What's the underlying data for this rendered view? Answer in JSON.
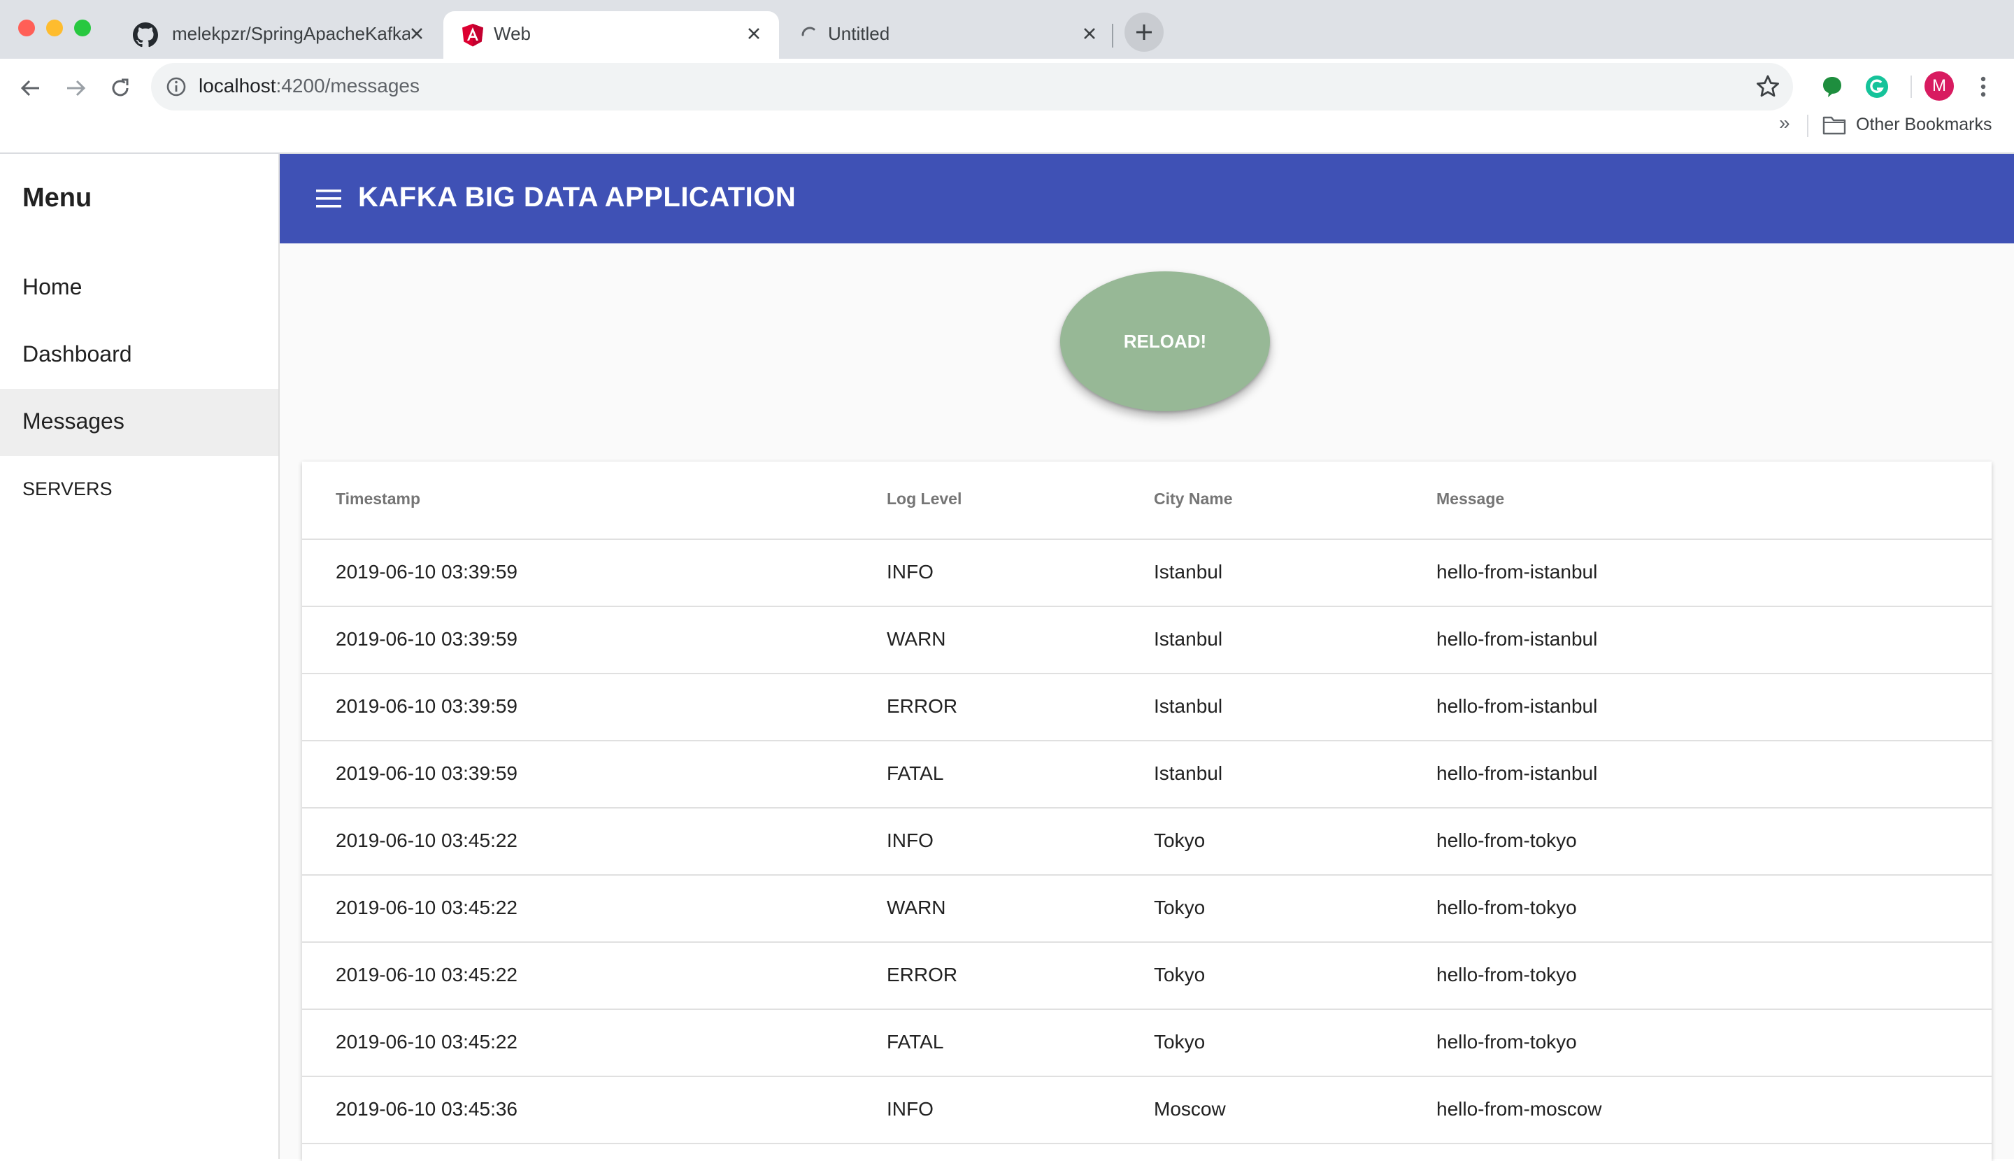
{
  "browser": {
    "tabs": [
      {
        "title": "melekpzr/SpringApacheKafka:",
        "icon": "github-icon"
      },
      {
        "title": "Web",
        "icon": "angular-icon"
      },
      {
        "title": "Untitled",
        "icon": "loading-spinner-icon"
      }
    ],
    "url_host": "localhost",
    "url_path": ":4200/messages",
    "profile_initial": "M",
    "bookmarks_overflow": "»",
    "other_bookmarks": "Other Bookmarks"
  },
  "sidebar": {
    "title": "Menu",
    "items": [
      {
        "label": "Home"
      },
      {
        "label": "Dashboard"
      },
      {
        "label": "Messages"
      },
      {
        "label": "SERVERS"
      }
    ]
  },
  "header": {
    "title": "KAFKA BIG DATA APPLICATION"
  },
  "reload_button": "RELOAD!",
  "table": {
    "columns": [
      "Timestamp",
      "Log Level",
      "City Name",
      "Message"
    ],
    "rows": [
      [
        "2019-06-10 03:39:59",
        "INFO",
        "Istanbul",
        "hello-from-istanbul"
      ],
      [
        "2019-06-10 03:39:59",
        "WARN",
        "Istanbul",
        "hello-from-istanbul"
      ],
      [
        "2019-06-10 03:39:59",
        "ERROR",
        "Istanbul",
        "hello-from-istanbul"
      ],
      [
        "2019-06-10 03:39:59",
        "FATAL",
        "Istanbul",
        "hello-from-istanbul"
      ],
      [
        "2019-06-10 03:45:22",
        "INFO",
        "Tokyo",
        "hello-from-tokyo"
      ],
      [
        "2019-06-10 03:45:22",
        "WARN",
        "Tokyo",
        "hello-from-tokyo"
      ],
      [
        "2019-06-10 03:45:22",
        "ERROR",
        "Tokyo",
        "hello-from-tokyo"
      ],
      [
        "2019-06-10 03:45:22",
        "FATAL",
        "Tokyo",
        "hello-from-tokyo"
      ],
      [
        "2019-06-10 03:45:36",
        "INFO",
        "Moscow",
        "hello-from-moscow"
      ]
    ]
  },
  "colors": {
    "appbar": "#3f51b5",
    "reload_button": "#97b896",
    "active_nav": "#eeeeee"
  }
}
